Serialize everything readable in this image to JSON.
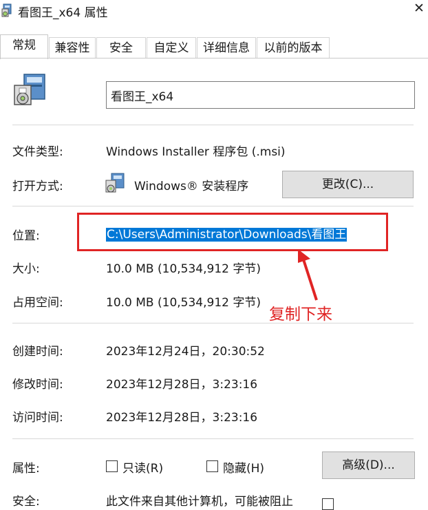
{
  "window": {
    "title": "看图王_x64 属性",
    "close_glyph": "✕"
  },
  "tabs": [
    {
      "label": "常规",
      "active": true
    },
    {
      "label": "兼容性"
    },
    {
      "label": "安全"
    },
    {
      "label": "自定义"
    },
    {
      "label": "详细信息"
    },
    {
      "label": "以前的版本"
    }
  ],
  "file": {
    "name": "看图王_x64",
    "icon": "msi-installer-icon"
  },
  "general": {
    "type_label": "文件类型:",
    "type_value": "Windows Installer 程序包 (.msi)",
    "open_label": "打开方式:",
    "open_value": "Windows® 安装程序",
    "change_button": "更改(C)...",
    "location_label": "位置:",
    "location_value": "C:\\Users\\Administrator\\Downloads\\看图王",
    "size_label": "大小:",
    "size_value": "10.0 MB (10,534,912 字节)",
    "disk_label": "占用空间:",
    "disk_value": "10.0 MB (10,534,912 字节)",
    "created_label": "创建时间:",
    "created_value": "2023年12月24日，20:30:52",
    "modified_label": "修改时间:",
    "modified_value": "2023年12月28日，3:23:16",
    "accessed_label": "访问时间:",
    "accessed_value": "2023年12月28日，3:23:16",
    "attributes_label": "属性:",
    "readonly_label": "只读(R)",
    "hidden_label": "隐藏(H)",
    "advanced_button": "高级(D)...",
    "security_label": "安全:",
    "security_value": "此文件来自其他计算机，可能被阻止"
  },
  "annotation": {
    "text": "复制下来",
    "color": "#e02424"
  },
  "colors": {
    "selection": "#0078d7",
    "accent_red": "#e02424"
  }
}
